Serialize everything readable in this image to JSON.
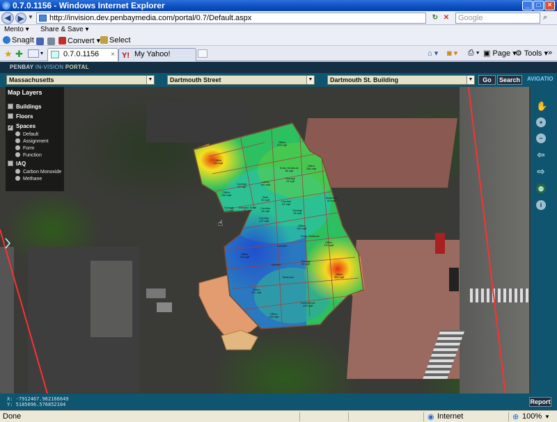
{
  "window": {
    "title": "0.7.0.1156 - Windows Internet Explorer"
  },
  "address": {
    "url": "http://invision.dev.penbaymedia.com/portal/0.7/Default.aspx",
    "search_placeholder": "Google"
  },
  "toolbar1": {
    "mento": "Mento",
    "share": "Share & Save"
  },
  "toolbar2": {
    "snagit": "SnagIt",
    "convert": "Convert",
    "select": "Select"
  },
  "tabs": [
    {
      "label": "0.7.0.1156"
    },
    {
      "label": "My Yahoo!"
    }
  ],
  "ie_tools": {
    "page": "Page",
    "tools": "Tools"
  },
  "portal": {
    "logo_brand": "PENBAY",
    "logo_product": "IN-VISION",
    "logo_suffix": "PORTAL"
  },
  "selectors": {
    "state": "Massachusetts",
    "street": "Dartmouth Street",
    "building": "Dartmouth St. Building",
    "go_label": "Go",
    "search_label": "Search",
    "navigation_label": "AVIGATIO"
  },
  "layers": {
    "title": "Map Layers",
    "items": [
      {
        "label": "Buildings",
        "checked": false
      },
      {
        "label": "Floors",
        "checked": false
      },
      {
        "label": "Spaces",
        "checked": true
      },
      {
        "label": "IAQ",
        "checked": false
      }
    ],
    "spaces_options": [
      "Default",
      "Assignment",
      "Form",
      "Function"
    ],
    "iaq_options": [
      "Carbon Monoxide",
      "Methane"
    ]
  },
  "rooms": [
    {
      "name": "Office",
      "area": "202 sqft"
    },
    {
      "name": "Office",
      "area": "153 sqft"
    },
    {
      "name": "Corridor",
      "area": "42 sqft"
    },
    {
      "name": "Lobby",
      "area": "160 sqft"
    },
    {
      "name": "Entry Vestibule",
      "area": "38 sqft"
    },
    {
      "name": "Storage",
      "area": "24 sqft"
    },
    {
      "name": "Office",
      "area": "160 sqft"
    },
    {
      "name": "Stair",
      "area": "30 sqft"
    },
    {
      "name": "Office",
      "area": "286 sqft"
    },
    {
      "name": "Corridor",
      "area": "62 sqft"
    },
    {
      "name": "Corridor",
      "area": "48 sqft"
    },
    {
      "name": "Storage",
      "area": "17 sqft"
    },
    {
      "name": "Elevator Shaft",
      "area": "31 sqft"
    },
    {
      "name": "Corridor",
      "area": "127 sqft"
    },
    {
      "name": "Bedroom",
      "area": "60 sqft"
    },
    {
      "name": "Storage",
      "area": "16 sqft"
    },
    {
      "name": "Office",
      "area": "154 sqft"
    },
    {
      "name": "Entry Vestibule",
      "area": ""
    },
    {
      "name": "Corridor",
      "area": ""
    },
    {
      "name": "Office",
      "area": "120 sqft"
    },
    {
      "name": "Office",
      "area": "103 sqft"
    },
    {
      "name": "Storage",
      "area": "22 sqft"
    },
    {
      "name": "Office",
      "area": "362 sqft"
    },
    {
      "name": "Kitchen",
      "area": ""
    },
    {
      "name": "Office",
      "area": "141 sqft"
    },
    {
      "name": "Bedroom",
      "area": ""
    },
    {
      "name": "Conference",
      "area": "400 sqft"
    },
    {
      "name": "Office",
      "area": "195 sqft"
    }
  ],
  "coords": {
    "x": "X: -7912467.962166649",
    "y": "Y: 5185096.576852104"
  },
  "report_label": "Report",
  "status": {
    "left": "Done",
    "zone": "Internet",
    "zoom": "100%"
  }
}
